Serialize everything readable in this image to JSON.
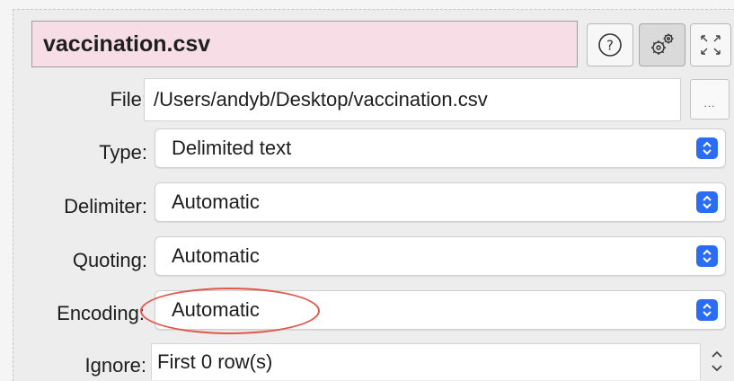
{
  "title": "vaccination.csv",
  "toolbar": {
    "help_icon": "help-icon",
    "settings_icon": "gears-icon",
    "expand_icon": "expand-icon"
  },
  "file": {
    "label": "File:",
    "value": "/Users/andyb/Desktop/vaccination.csv",
    "browse_label": "..."
  },
  "type": {
    "label": "Type:",
    "value": "Delimited text"
  },
  "delimiter": {
    "label": "Delimiter:",
    "value": "Automatic"
  },
  "quoting": {
    "label": "Quoting:",
    "value": "Automatic"
  },
  "encoding": {
    "label": "Encoding:",
    "value": "Automatic"
  },
  "ignore": {
    "label": "Ignore:",
    "value": "First 0 row(s)"
  },
  "colors": {
    "title_bg": "#f7dde6",
    "accent": "#2a6df4",
    "highlight": "#e2574c"
  }
}
